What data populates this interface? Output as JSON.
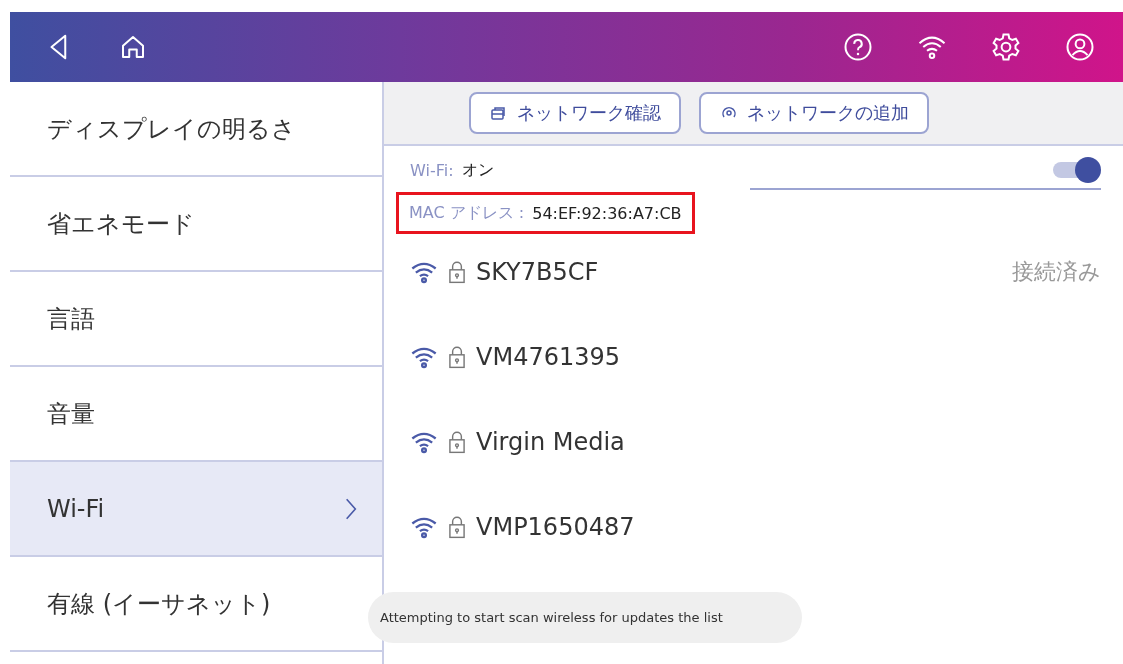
{
  "sidebar": {
    "items": [
      {
        "label": "ディスプレイの明るさ",
        "selected": false
      },
      {
        "label": "省エネモード",
        "selected": false
      },
      {
        "label": "言語",
        "selected": false
      },
      {
        "label": "音量",
        "selected": false
      },
      {
        "label": "Wi-Fi",
        "selected": true
      },
      {
        "label": "有線 (イーサネット)",
        "selected": false
      }
    ]
  },
  "toolbar": {
    "buttons": [
      {
        "kind": "check",
        "label": "ネットワーク確認"
      },
      {
        "kind": "add",
        "label": "ネットワークの追加"
      }
    ]
  },
  "wifi": {
    "label": "Wi-Fi:",
    "value": "オン",
    "on": true
  },
  "mac": {
    "label": "MAC アドレス :",
    "value": "54:EF:92:36:A7:CB",
    "highlighted": true
  },
  "networks": [
    {
      "name": "SKY7B5CF",
      "locked": true,
      "status": "接続済み"
    },
    {
      "name": "VM4761395",
      "locked": true
    },
    {
      "name": "Virgin Media",
      "locked": true
    },
    {
      "name": "VMP1650487",
      "locked": true
    }
  ],
  "toast": "Attempting to start scan wireless for updates the list"
}
